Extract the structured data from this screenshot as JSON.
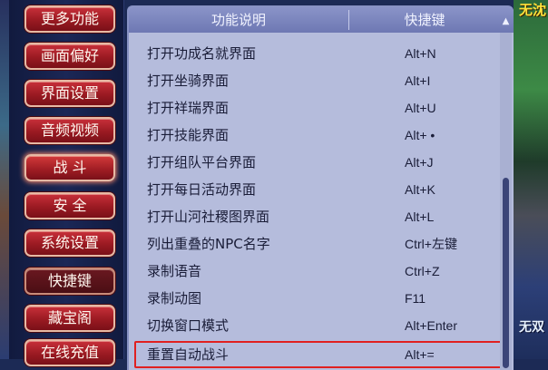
{
  "menu": {
    "items": [
      {
        "label": "更多功能"
      },
      {
        "label": "画面偏好"
      },
      {
        "label": "界面设置"
      },
      {
        "label": "音频视频"
      },
      {
        "label": "战 斗"
      },
      {
        "label": "安 全"
      },
      {
        "label": "系统设置"
      },
      {
        "label": "快捷键"
      },
      {
        "label": "藏宝阁"
      },
      {
        "label": "在线充值"
      }
    ],
    "selected": "快捷键"
  },
  "table": {
    "headers": {
      "function": "功能说明",
      "hotkey": "快捷键"
    },
    "rows": [
      {
        "function": "打开功成名就界面",
        "hotkey": "Alt+N"
      },
      {
        "function": "打开坐骑界面",
        "hotkey": "Alt+I"
      },
      {
        "function": "打开祥瑞界面",
        "hotkey": "Alt+U"
      },
      {
        "function": "打开技能界面",
        "hotkey": "Alt+ •"
      },
      {
        "function": "打开组队平台界面",
        "hotkey": "Alt+J"
      },
      {
        "function": "打开每日活动界面",
        "hotkey": "Alt+K"
      },
      {
        "function": "打开山河社稷图界面",
        "hotkey": "Alt+L"
      },
      {
        "function": "列出重叠的NPC名字",
        "hotkey": "Ctrl+左键"
      },
      {
        "function": "录制语音",
        "hotkey": "Ctrl+Z"
      },
      {
        "function": "录制动图",
        "hotkey": "F11"
      },
      {
        "function": "切换窗口模式",
        "hotkey": "Alt+Enter"
      },
      {
        "function": "重置自动战斗",
        "hotkey": "Alt+="
      }
    ],
    "highlighted_row": "重置自动战斗"
  },
  "background": {
    "top_right_text": "无沈",
    "bottom_right_text": "无双"
  },
  "colors": {
    "menu_button": "#b0222b",
    "panel_bg": "#b5bcdc",
    "header_bg": "#7a84bd",
    "highlight_border": "#e02020"
  }
}
